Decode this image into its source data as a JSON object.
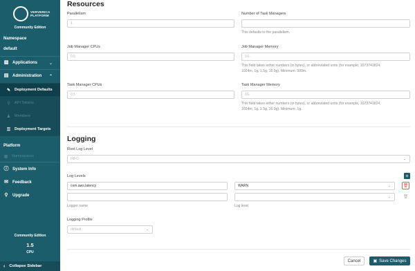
{
  "sidebar": {
    "logo_line1": "VERVERICA",
    "logo_line2": "PLATFORM",
    "edition": "Community Edition",
    "namespace_label": "Namespace",
    "namespace_value": "default",
    "applications": "Applications",
    "administration": "Administration",
    "deployment_defaults": "Deployment Defaults",
    "api_tokens": "API Tokens",
    "members": "Members",
    "deployment_targets": "Deployment Targets",
    "platform_label": "Platform",
    "namespaces": "Namespaces",
    "system_info": "System Info",
    "feedback": "Feedback",
    "upgrade": "Upgrade",
    "footer_edition": "Community Edition",
    "cpu_value": "1.5",
    "cpu_label": "CPU",
    "collapse": "Collapse Sidebar"
  },
  "resources": {
    "title": "Resources",
    "parallelism_label": "Parallelism",
    "parallelism_placeholder": "1",
    "task_managers_label": "Number of Task Managers",
    "task_managers_help": "This defaults to the parallelism.",
    "jm_cpu_label": "Job Manager CPUs",
    "jm_cpu_placeholder": "0.5",
    "jm_memory_label": "Job Manager Memory",
    "jm_memory_placeholder": "1G",
    "jm_memory_help1": "This field takes either numbers (in bytes), or abbreviated units (for example, 1073741824,",
    "jm_memory_help2": "1024m, 1g, 1.5g, 16.0g). Minimum: 500m.",
    "tm_cpu_label": "Task Manager CPUs",
    "tm_cpu_placeholder": "0.5",
    "tm_memory_label": "Task Manager Memory",
    "tm_memory_placeholder": "1G",
    "tm_memory_help1": "This field takes either numbers (in bytes), or abbreviated units (for example, 1073741824,",
    "tm_memory_help2": "1024m, 1g, 1.5g, 16.0g). Minimum: 1g."
  },
  "logging": {
    "title": "Logging",
    "root_level_label": "Root Log Level",
    "root_level_value": "INFO",
    "log_levels_label": "Log Levels",
    "rows": [
      {
        "logger": "com.aws.latency",
        "level": "WARN"
      },
      {
        "logger": "",
        "level": ""
      }
    ],
    "logger_name_label": "Logger name",
    "log_level_label": "Log level",
    "profile_label": "Logging Profile",
    "profile_value": "default"
  },
  "actions": {
    "cancel": "Cancel",
    "save": "Save Changes"
  },
  "colors": {
    "sidebar": "#1c5d6b",
    "accent": "#1c5d6b",
    "danger": "#e05a4e"
  }
}
